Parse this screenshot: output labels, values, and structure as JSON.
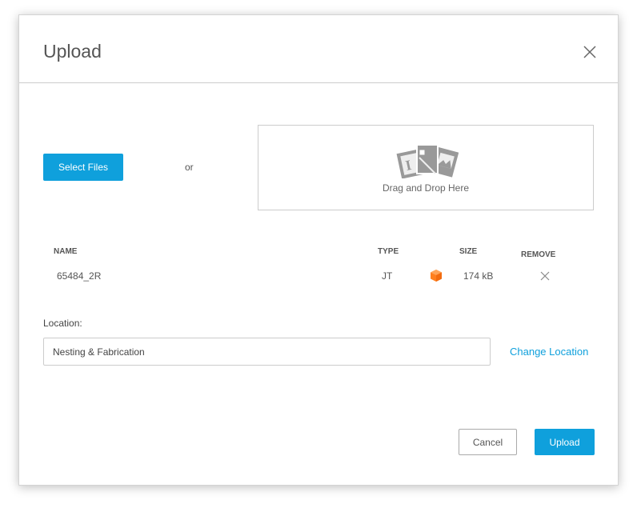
{
  "dialog": {
    "title": "Upload",
    "close_icon": "close-icon"
  },
  "select_files": "Select Files",
  "or": "or",
  "dropzone": {
    "label": "Drag and Drop Here",
    "icon": "files-icon"
  },
  "table": {
    "headers": {
      "name": "NAME",
      "type": "TYPE",
      "size": "SIZE",
      "remove": "REMOVE"
    },
    "rows": [
      {
        "name": "65484_2R",
        "type": "JT",
        "type_icon": "cube-icon",
        "size": "174 kB"
      }
    ]
  },
  "location": {
    "label": "Location:",
    "value": "Nesting & Fabrication",
    "change": "Change Location"
  },
  "buttons": {
    "cancel": "Cancel",
    "upload": "Upload"
  },
  "colors": {
    "accent": "#0fa0dc",
    "cube": "#ff7f1e"
  }
}
